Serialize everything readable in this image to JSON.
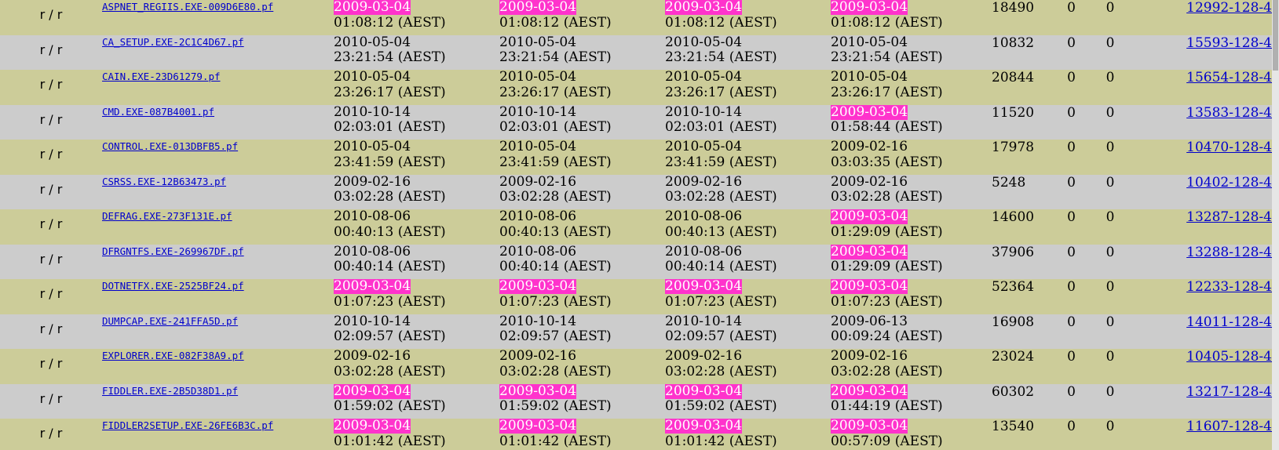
{
  "colors": {
    "row_even": "#cccc99",
    "row_odd": "#cccccc",
    "highlight": "#ff33cc",
    "link": "#0000cc"
  },
  "rows": [
    {
      "type": "r / r",
      "name": "ASPNET_REGIIS.EXE-009D6E80.pf",
      "times": [
        {
          "date": "2009-03-04",
          "time": "01:08:12 (AEST)",
          "hl": true
        },
        {
          "date": "2009-03-04",
          "time": "01:08:12 (AEST)",
          "hl": true
        },
        {
          "date": "2009-03-04",
          "time": "01:08:12 (AEST)",
          "hl": true
        },
        {
          "date": "2009-03-04",
          "time": "01:08:12 (AEST)",
          "hl": true
        }
      ],
      "size": "18490",
      "uid": "0",
      "gid": "0",
      "meta": "12992-128-4"
    },
    {
      "type": "r / r",
      "name": "CA_SETUP.EXE-2C1C4D67.pf",
      "times": [
        {
          "date": "2010-05-04",
          "time": "23:21:54 (AEST)",
          "hl": false
        },
        {
          "date": "2010-05-04",
          "time": "23:21:54 (AEST)",
          "hl": false
        },
        {
          "date": "2010-05-04",
          "time": "23:21:54 (AEST)",
          "hl": false
        },
        {
          "date": "2010-05-04",
          "time": "23:21:54 (AEST)",
          "hl": false
        }
      ],
      "size": "10832",
      "uid": "0",
      "gid": "0",
      "meta": "15593-128-4"
    },
    {
      "type": "r / r",
      "name": "CAIN.EXE-23D61279.pf",
      "times": [
        {
          "date": "2010-05-04",
          "time": "23:26:17 (AEST)",
          "hl": false
        },
        {
          "date": "2010-05-04",
          "time": "23:26:17 (AEST)",
          "hl": false
        },
        {
          "date": "2010-05-04",
          "time": "23:26:17 (AEST)",
          "hl": false
        },
        {
          "date": "2010-05-04",
          "time": "23:26:17 (AEST)",
          "hl": false
        }
      ],
      "size": "20844",
      "uid": "0",
      "gid": "0",
      "meta": "15654-128-4"
    },
    {
      "type": "r / r",
      "name": "CMD.EXE-087B4001.pf",
      "times": [
        {
          "date": "2010-10-14",
          "time": "02:03:01 (AEST)",
          "hl": false
        },
        {
          "date": "2010-10-14",
          "time": "02:03:01 (AEST)",
          "hl": false
        },
        {
          "date": "2010-10-14",
          "time": "02:03:01 (AEST)",
          "hl": false
        },
        {
          "date": "2009-03-04",
          "time": "01:58:44 (AEST)",
          "hl": true
        }
      ],
      "size": "11520",
      "uid": "0",
      "gid": "0",
      "meta": "13583-128-4"
    },
    {
      "type": "r / r",
      "name": "CONTROL.EXE-013DBFB5.pf",
      "times": [
        {
          "date": "2010-05-04",
          "time": "23:41:59 (AEST)",
          "hl": false
        },
        {
          "date": "2010-05-04",
          "time": "23:41:59 (AEST)",
          "hl": false
        },
        {
          "date": "2010-05-04",
          "time": "23:41:59 (AEST)",
          "hl": false
        },
        {
          "date": "2009-02-16",
          "time": "03:03:35 (AEST)",
          "hl": false
        }
      ],
      "size": "17978",
      "uid": "0",
      "gid": "0",
      "meta": "10470-128-4"
    },
    {
      "type": "r / r",
      "name": "CSRSS.EXE-12B63473.pf",
      "times": [
        {
          "date": "2009-02-16",
          "time": "03:02:28 (AEST)",
          "hl": false
        },
        {
          "date": "2009-02-16",
          "time": "03:02:28 (AEST)",
          "hl": false
        },
        {
          "date": "2009-02-16",
          "time": "03:02:28 (AEST)",
          "hl": false
        },
        {
          "date": "2009-02-16",
          "time": "03:02:28 (AEST)",
          "hl": false
        }
      ],
      "size": "5248",
      "uid": "0",
      "gid": "0",
      "meta": "10402-128-4"
    },
    {
      "type": "r / r",
      "name": "DEFRAG.EXE-273F131E.pf",
      "times": [
        {
          "date": "2010-08-06",
          "time": "00:40:13 (AEST)",
          "hl": false
        },
        {
          "date": "2010-08-06",
          "time": "00:40:13 (AEST)",
          "hl": false
        },
        {
          "date": "2010-08-06",
          "time": "00:40:13 (AEST)",
          "hl": false
        },
        {
          "date": "2009-03-04",
          "time": "01:29:09 (AEST)",
          "hl": true
        }
      ],
      "size": "14600",
      "uid": "0",
      "gid": "0",
      "meta": "13287-128-4"
    },
    {
      "type": "r / r",
      "name": "DFRGNTFS.EXE-269967DF.pf",
      "times": [
        {
          "date": "2010-08-06",
          "time": "00:40:14 (AEST)",
          "hl": false
        },
        {
          "date": "2010-08-06",
          "time": "00:40:14 (AEST)",
          "hl": false
        },
        {
          "date": "2010-08-06",
          "time": "00:40:14 (AEST)",
          "hl": false
        },
        {
          "date": "2009-03-04",
          "time": "01:29:09 (AEST)",
          "hl": true
        }
      ],
      "size": "37906",
      "uid": "0",
      "gid": "0",
      "meta": "13288-128-4"
    },
    {
      "type": "r / r",
      "name": "DOTNETFX.EXE-2525BF24.pf",
      "times": [
        {
          "date": "2009-03-04",
          "time": "01:07:23 (AEST)",
          "hl": true
        },
        {
          "date": "2009-03-04",
          "time": "01:07:23 (AEST)",
          "hl": true
        },
        {
          "date": "2009-03-04",
          "time": "01:07:23 (AEST)",
          "hl": true
        },
        {
          "date": "2009-03-04",
          "time": "01:07:23 (AEST)",
          "hl": true
        }
      ],
      "size": "52364",
      "uid": "0",
      "gid": "0",
      "meta": "12233-128-4"
    },
    {
      "type": "r / r",
      "name": "DUMPCAP.EXE-241FFA5D.pf",
      "times": [
        {
          "date": "2010-10-14",
          "time": "02:09:57 (AEST)",
          "hl": false
        },
        {
          "date": "2010-10-14",
          "time": "02:09:57 (AEST)",
          "hl": false
        },
        {
          "date": "2010-10-14",
          "time": "02:09:57 (AEST)",
          "hl": false
        },
        {
          "date": "2009-06-13",
          "time": "00:09:24 (AEST)",
          "hl": false
        }
      ],
      "size": "16908",
      "uid": "0",
      "gid": "0",
      "meta": "14011-128-4"
    },
    {
      "type": "r / r",
      "name": "EXPLORER.EXE-082F38A9.pf",
      "times": [
        {
          "date": "2009-02-16",
          "time": "03:02:28 (AEST)",
          "hl": false
        },
        {
          "date": "2009-02-16",
          "time": "03:02:28 (AEST)",
          "hl": false
        },
        {
          "date": "2009-02-16",
          "time": "03:02:28 (AEST)",
          "hl": false
        },
        {
          "date": "2009-02-16",
          "time": "03:02:28 (AEST)",
          "hl": false
        }
      ],
      "size": "23024",
      "uid": "0",
      "gid": "0",
      "meta": "10405-128-4"
    },
    {
      "type": "r / r",
      "name": "FIDDLER.EXE-2B5D38D1.pf",
      "times": [
        {
          "date": "2009-03-04",
          "time": "01:59:02 (AEST)",
          "hl": true
        },
        {
          "date": "2009-03-04",
          "time": "01:59:02 (AEST)",
          "hl": true
        },
        {
          "date": "2009-03-04",
          "time": "01:59:02 (AEST)",
          "hl": true
        },
        {
          "date": "2009-03-04",
          "time": "01:44:19 (AEST)",
          "hl": true
        }
      ],
      "size": "60302",
      "uid": "0",
      "gid": "0",
      "meta": "13217-128-4"
    },
    {
      "type": "r / r",
      "name": "FIDDLER2SETUP.EXE-26FE6B3C.pf",
      "times": [
        {
          "date": "2009-03-04",
          "time": "01:01:42 (AEST)",
          "hl": true
        },
        {
          "date": "2009-03-04",
          "time": "01:01:42 (AEST)",
          "hl": true
        },
        {
          "date": "2009-03-04",
          "time": "01:01:42 (AEST)",
          "hl": true
        },
        {
          "date": "2009-03-04",
          "time": "00:57:09 (AEST)",
          "hl": true
        }
      ],
      "size": "13540",
      "uid": "0",
      "gid": "0",
      "meta": "11607-128-4"
    }
  ]
}
